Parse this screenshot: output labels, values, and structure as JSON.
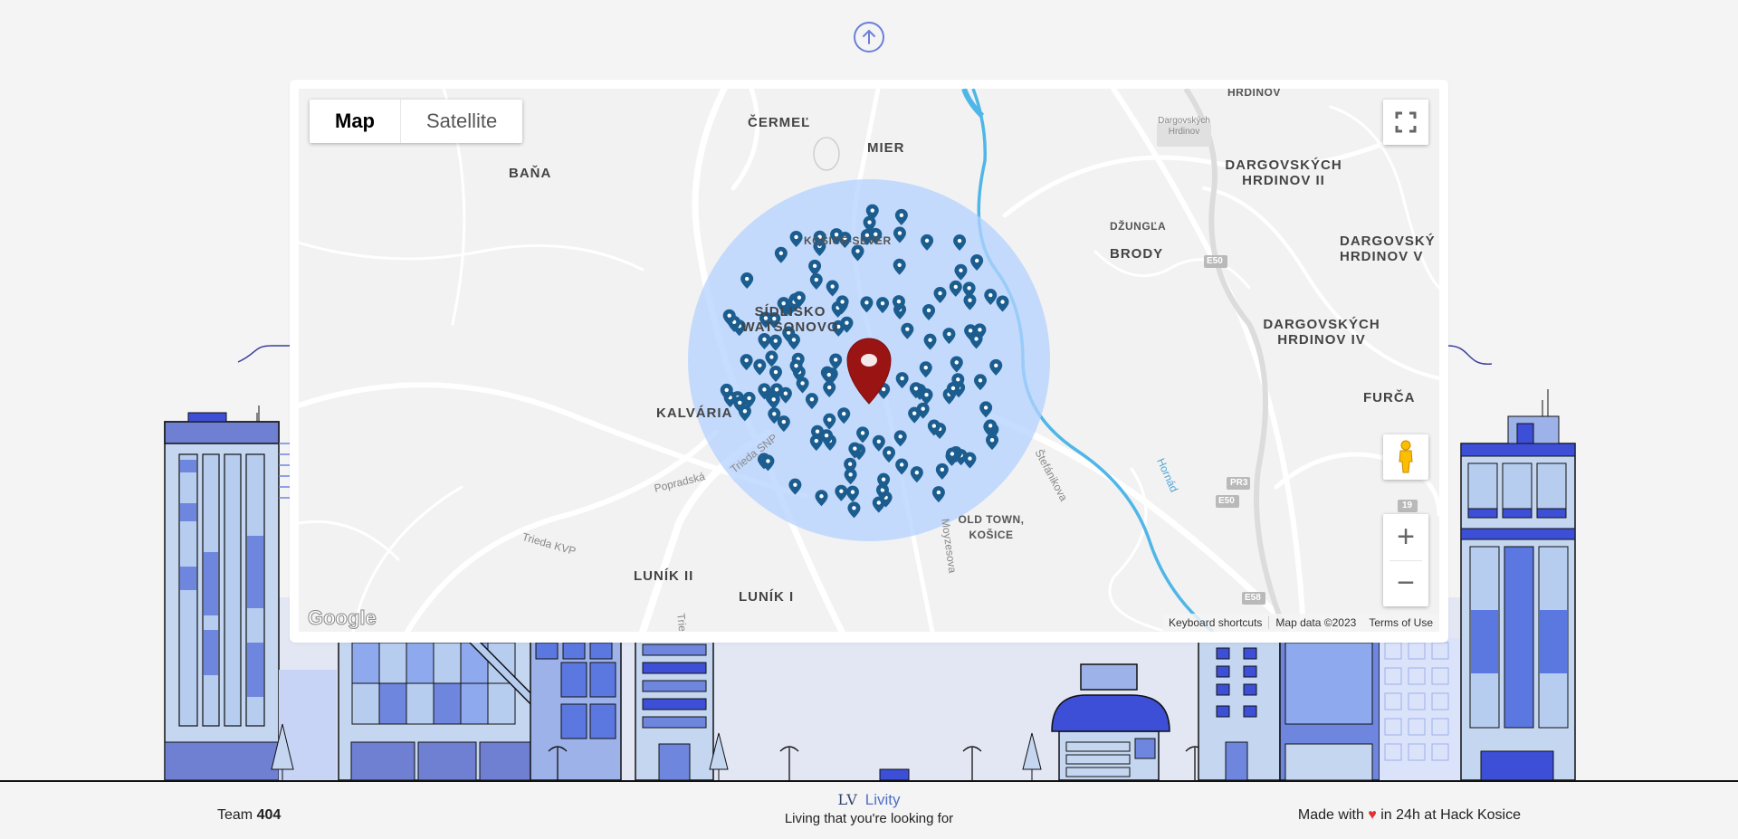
{
  "map": {
    "type_control": {
      "map_label": "Map",
      "satellite_label": "Satellite",
      "selected": "Map"
    },
    "place_labels": {
      "cermel": "ČERMEĽ",
      "mier": "MIER",
      "hrdinov": "HRDINOV",
      "dargovskych_box": "Dargovských Hrdinov",
      "bana": "BAŇA",
      "dargovskych_2": "DARGOVSKÝCH HRDINOV II",
      "kosice_sever": "KOŠICE-SEVER",
      "dzungla": "DŽUNGĽA",
      "brody": "BRODY",
      "dargovskych_5": "DARGOVSKÝ HRDINOV V",
      "sidlisko": "SÍDLISKO WATSONOVO",
      "dargovskych_4": "DARGOVSKÝCH HRDINOV IV",
      "kalvaria": "KALVÁRIA",
      "furca": "FURČA",
      "old_town": "OLD TOWN, KOŠICE",
      "lunik2": "LUNÍK II",
      "lunik1": "LUNÍK I"
    },
    "street_labels": {
      "popradska": "Popradská",
      "trieda_snp": "Trieda SNP",
      "trieda_kvp": "Trieda KVP",
      "stefanikova": "Štefánikova",
      "moyzesova": "Moyzesova",
      "hornad": "Hornád",
      "trieda": "Tried"
    },
    "road_shields": {
      "e50_a": "E50",
      "e50_b": "E50",
      "pr3": "PR3",
      "r19": "19",
      "e58": "E58"
    },
    "attribution": {
      "keyboard": "Keyboard shortcuts",
      "data": "Map data ©2023",
      "terms": "Terms of Use"
    },
    "logo_text": "Google",
    "zoom_in": "+",
    "zoom_out": "−",
    "colors": {
      "radius_fill": "#b3d1ff",
      "marker": "#1c5d8f",
      "center_marker": "#9b1414",
      "river": "#4fb6e8"
    }
  },
  "footer": {
    "team_prefix": "Team",
    "team_number": "404",
    "brand_logo": "LV",
    "brand_name": "Livity",
    "tagline": "Living that you're looking for",
    "made_prefix": "Made with",
    "made_suffix": "in 24h at Hack Kosice"
  }
}
